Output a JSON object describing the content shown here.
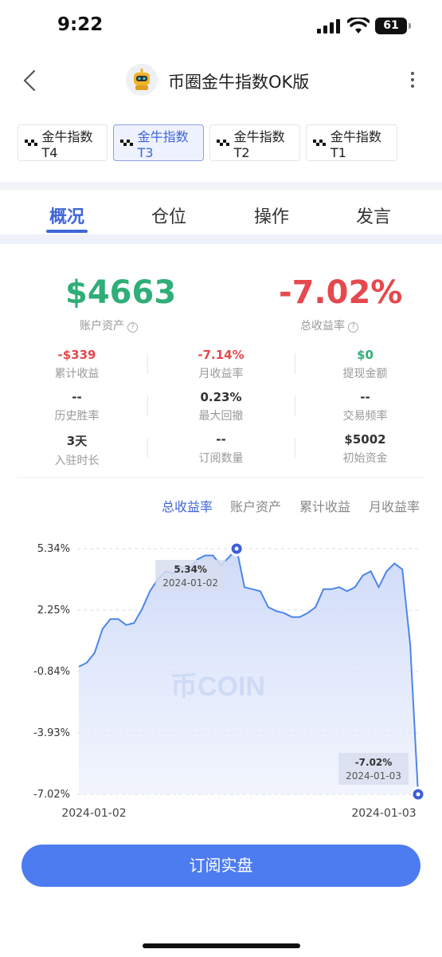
{
  "status_bar": {
    "time": "9:22",
    "battery": "61"
  },
  "nav": {
    "title": "币圈金牛指数OK版"
  },
  "version_tabs": [
    {
      "label": "金牛指数T4"
    },
    {
      "label": "金牛指数T3"
    },
    {
      "label": "金牛指数T2"
    },
    {
      "label": "金牛指数T1"
    }
  ],
  "section_tabs": [
    {
      "label": "概况"
    },
    {
      "label": "仓位"
    },
    {
      "label": "操作"
    },
    {
      "label": "发言"
    }
  ],
  "summary": {
    "assets_value": "$4663",
    "assets_label": "账户资产",
    "return_value": "-7.02%",
    "return_label": "总收益率"
  },
  "stats": [
    {
      "value": "-$339",
      "label": "累计收益"
    },
    {
      "value": "-7.14%",
      "label": "月收益率"
    },
    {
      "value": "$0",
      "label": "提现金额"
    },
    {
      "value": "--",
      "label": "历史胜率"
    },
    {
      "value": "0.23%",
      "label": "最大回撤"
    },
    {
      "value": "--",
      "label": "交易频率"
    },
    {
      "value": "3天",
      "label": "入驻时长"
    },
    {
      "value": "--",
      "label": "订阅数量"
    },
    {
      "value": "$5002",
      "label": "初始资金"
    }
  ],
  "chart_tabs": [
    {
      "label": "总收益率"
    },
    {
      "label": "账户资产"
    },
    {
      "label": "累计收益"
    },
    {
      "label": "月收益率"
    }
  ],
  "watermark": "币COIN",
  "colors": {
    "accent": "#3f66d8",
    "positive": "#2fae78",
    "negative": "#e5484d",
    "button": "#4d7cf0"
  },
  "chart_data": {
    "type": "area",
    "y_ticks": [
      "5.34%",
      "2.25%",
      "-0.84%",
      "-3.93%",
      "-7.02%"
    ],
    "y_tick_values": [
      5.34,
      2.25,
      -0.84,
      -3.93,
      -7.02
    ],
    "ylim": [
      -7.02,
      5.34
    ],
    "x_ticks": [
      "2024-01-02",
      "2024-01-03"
    ],
    "values": [
      -0.6,
      -0.4,
      0.1,
      1.3,
      1.8,
      1.8,
      1.5,
      1.6,
      2.3,
      3.2,
      3.8,
      4.2,
      4.1,
      4.4,
      4.3,
      4.8,
      5.0,
      5.0,
      4.5,
      4.9,
      5.34,
      3.4,
      3.3,
      3.2,
      2.4,
      2.2,
      2.1,
      1.9,
      1.9,
      2.1,
      2.4,
      3.3,
      3.3,
      3.4,
      3.2,
      3.4,
      4.0,
      4.2,
      3.4,
      4.2,
      4.6,
      4.3,
      0.5,
      -7.02
    ],
    "annotations": [
      {
        "value": "5.34%",
        "date": "2024-01-02"
      },
      {
        "value": "-7.02%",
        "date": "2024-01-03"
      }
    ]
  },
  "subscribe_label": "订阅实盘"
}
